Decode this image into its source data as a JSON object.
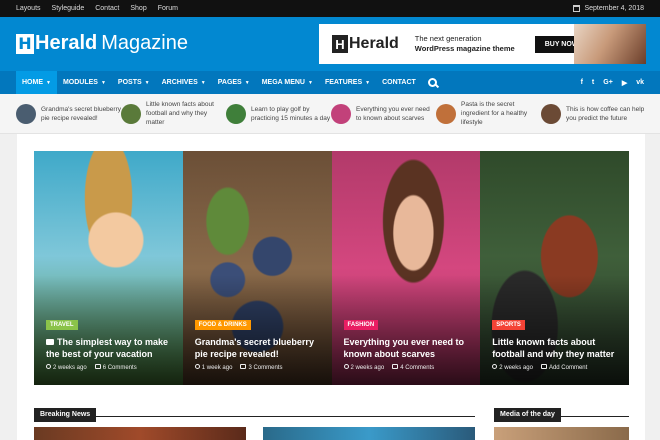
{
  "topbar": {
    "links": [
      "Layouts",
      "Styleguide",
      "Contact",
      "Shop",
      "Forum"
    ],
    "date": "September 4, 2018"
  },
  "logo": {
    "bold": "Herald",
    "light": "Magazine"
  },
  "ad": {
    "brand": "Herald",
    "line1": "The next generation",
    "line2": "WordPress magazine theme",
    "cta": "BUY NOW!"
  },
  "nav": {
    "items": [
      "HOME",
      "MODULES",
      "POSTS",
      "ARCHIVES",
      "PAGES",
      "MEGA MENU",
      "FEATURES",
      "CONTACT"
    ],
    "social": [
      "f",
      "t",
      "G+",
      "▶",
      "vk"
    ]
  },
  "ticker": [
    {
      "text": "Grandma's secret blueberry pie recipe revealed!",
      "color": "#4a5d70"
    },
    {
      "text": "Little known facts about football and why they matter",
      "color": "#5a7a3a"
    },
    {
      "text": "Learn to play golf by practicing 15 minutes a day",
      "color": "#3f7f3a"
    },
    {
      "text": "Everything you ever need to known about scarves",
      "color": "#c2417a"
    },
    {
      "text": "Pasta is the secret ingredient for a healthy lifestyle",
      "color": "#c0703a"
    },
    {
      "text": "This is how coffee can help you predict the future",
      "color": "#6b4a35"
    }
  ],
  "featured": [
    {
      "category": "TRAVEL",
      "badge_color": "#8bc34a",
      "title": "The simplest way to make the best of your vacation",
      "time": "2 weeks ago",
      "comments": "6 Comments",
      "has_camera": true
    },
    {
      "category": "FOOD & DRINKS",
      "badge_color": "#ff9800",
      "title": "Grandma's secret blueberry pie recipe revealed!",
      "time": "1 week ago",
      "comments": "3 Comments",
      "has_camera": false
    },
    {
      "category": "FASHION",
      "badge_color": "#e91e63",
      "title": "Everything you ever need to known about scarves",
      "time": "2 weeks ago",
      "comments": "4 Comments",
      "has_camera": false
    },
    {
      "category": "SPORTS",
      "badge_color": "#f44336",
      "title": "Little known facts about football and why they matter",
      "time": "2 weeks ago",
      "comments": "Add Comment",
      "has_camera": false
    }
  ],
  "sections": {
    "breaking": "Breaking News",
    "media": "Media of the day"
  }
}
